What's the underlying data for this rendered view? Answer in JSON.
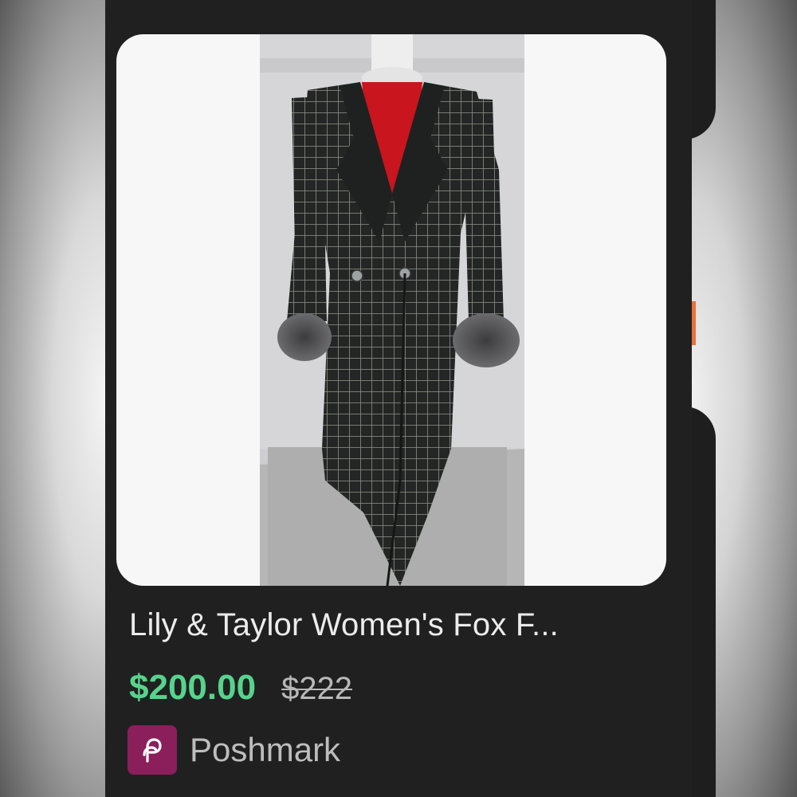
{
  "listing": {
    "title": "Lily & Taylor Women's Fox F...",
    "price": "$200.00",
    "original_price": "$222",
    "store": {
      "name": "Poshmark",
      "icon": "poshmark-logo-icon",
      "icon_color": "#8a1f5b"
    },
    "price_color": "#57d38c"
  }
}
